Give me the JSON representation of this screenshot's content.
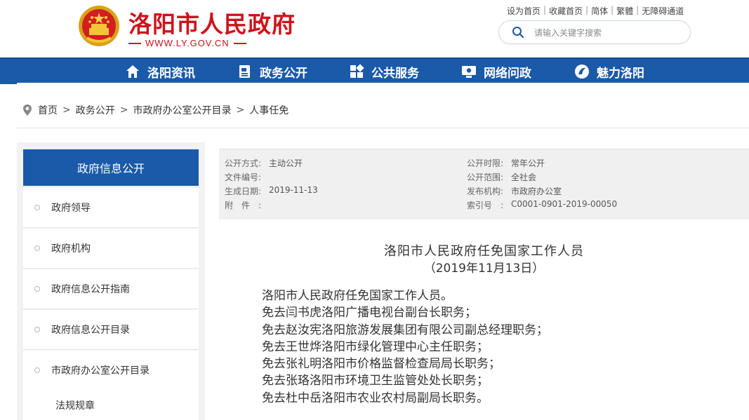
{
  "header": {
    "title": "洛阳市人民政府",
    "url": "WWW.LY.GOV.CN",
    "top_links": [
      "设为首页",
      "收藏首页",
      "简体",
      "繁體",
      "无障碍通道"
    ],
    "search_placeholder": "请输入关键字搜索",
    "brand_red": "#d0121b",
    "emblem_icon": "national-emblem-icon"
  },
  "nav": {
    "color": "#1a5aa8",
    "items": [
      {
        "label": "洛阳资讯",
        "icon": "home-icon"
      },
      {
        "label": "政务公开",
        "icon": "document-icon"
      },
      {
        "label": "公共服务",
        "icon": "grid-icon"
      },
      {
        "label": "网络问政",
        "icon": "monitor-icon"
      },
      {
        "label": "魅力洛阳",
        "icon": "circle-brand-icon"
      }
    ]
  },
  "breadcrumb": {
    "icon": "location-pin-icon",
    "items": [
      "首页",
      "政务公开",
      "市政府办公室公开目录",
      "人事任免"
    ],
    "separator": ">"
  },
  "sidebar": {
    "heading": "政府信息公开",
    "items": [
      "政府领导",
      "政府机构",
      "政府信息公开指南",
      "政府信息公开目录",
      "市政府办公室公开目录"
    ],
    "sub_item": "法规规章"
  },
  "meta": {
    "left": [
      {
        "key": "公开方式:",
        "value": "主动公开"
      },
      {
        "key": "文件编号:",
        "value": ""
      },
      {
        "key": "生成日期:",
        "value": "2019-11-13"
      },
      {
        "key": "附　件　:",
        "value": ""
      }
    ],
    "right": [
      {
        "key": "公开时限:",
        "value": "常年公开"
      },
      {
        "key": "公开范围:",
        "value": "全社会"
      },
      {
        "key": "发布机构:",
        "value": "市政府办公室"
      },
      {
        "key": "索引号　:",
        "value": "C0001-0901-2019-00050"
      }
    ]
  },
  "article": {
    "title": "洛阳市人民政府任免国家工作人员",
    "date": "（2019年11月13日）",
    "lines": [
      "洛阳市人民政府任免国家工作人员。",
      "免去闫书虎洛阳广播电视台副台长职务；",
      "免去赵汝宪洛阳旅游发展集团有限公司副总经理职务；",
      "免去王世烨洛阳市绿化管理中心主任职务；",
      "免去张礼明洛阳市价格监督检查局局长职务；",
      "免去张珞洛阳市环境卫生监管处处长职务；",
      "免去杜中岳洛阳市农业农村局副局长职务。"
    ]
  }
}
